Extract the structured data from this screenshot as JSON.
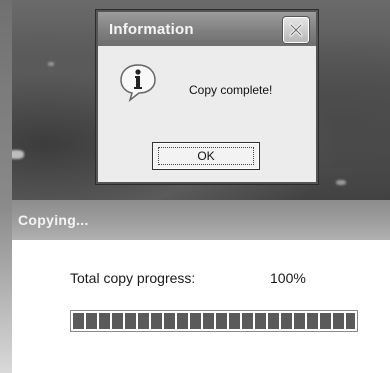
{
  "info_dialog": {
    "title": "Information",
    "message": "Copy complete!",
    "ok_label": "OK",
    "icon": "info-balloon-icon",
    "close_icon": "close-icon"
  },
  "progress_dialog": {
    "title": "Copying...",
    "label": "Total copy progress:",
    "percent_text": "100%",
    "progress_fraction": 1.0
  },
  "colors": {
    "titlebar": "#7e7e7e",
    "progress_block": "#5a5a5a",
    "dialog_body": "#ececec"
  }
}
